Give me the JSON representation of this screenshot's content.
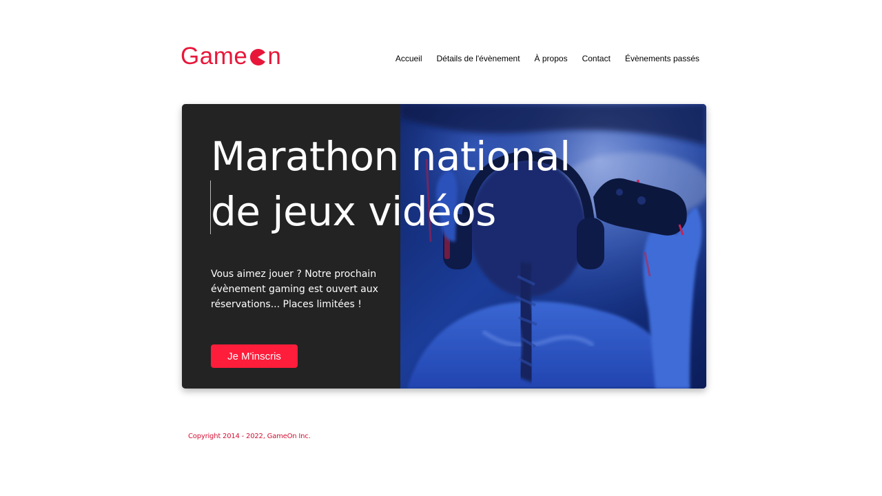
{
  "brand": {
    "logo_text_start": "Game",
    "logo_text_end": "n",
    "color": "#e8173a"
  },
  "nav": {
    "items": [
      {
        "label": "Accueil"
      },
      {
        "label": "Détails de l'évènement"
      },
      {
        "label": "À propos"
      },
      {
        "label": "Contact"
      },
      {
        "label": "Évènements passés"
      }
    ]
  },
  "hero": {
    "title_line1": "Marathon national",
    "title_line2": "de jeux vidéos",
    "description": "Vous aimez jouer ? Notre prochain évènement gaming est ouvert aux réservations... Places limitées !",
    "cta_label": "Je M'inscris",
    "cta_color": "#fe1d3b",
    "background_color": "#232323",
    "image_icon": "gamer-with-controller-photo"
  },
  "footer": {
    "copyright": "Copyright 2014 - 2022, GameOn Inc."
  }
}
